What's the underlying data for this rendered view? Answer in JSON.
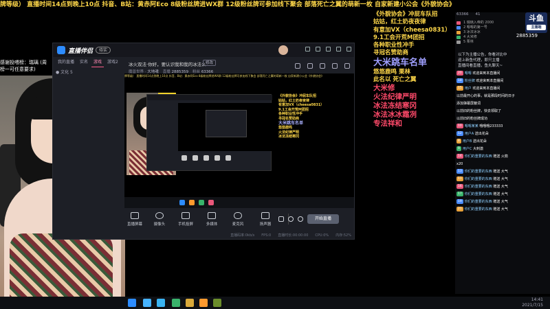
{
  "marquee": "牌等级） 直播时间14点到晚上10点 抖音、B站：黄赤阿Eco 8级粉丝牌进WX群 12级粉丝牌可参加线下聚会 部落死亡之翼的萌新一枚 自家新建小公会《外貌协会》",
  "cam_caption": "感谢投喂榜：瑞璃 (周榜一可任意要求)",
  "overlay": {
    "lines": [
      "《外貌协会》冲屁车队招",
      "姑姑，红土奶夜夜律",
      "有意加VX（cheesa0831）",
      "9.1工会开荒M团招",
      "各种职业性冲手",
      "寻冠名赞助商"
    ],
    "title": "大米跳车名单",
    "names": [
      "悠悠鹿鸣",
      "栗林",
      "此名以",
      "死亡之翼",
      "大米修",
      "火法纪律严明",
      "冰法冻结寒冈",
      "冰法冰冰霜冽",
      "专法祥和"
    ]
  },
  "app": {
    "name": "直播伴侣",
    "badge": "待实",
    "tabs": [
      "我的直播",
      "实名",
      "游戏",
      "游戏2"
    ],
    "sub": "● 文化 5",
    "room_title": "冰火双法·你好，要认识我和我的冰法么",
    "room_edit": "修改",
    "meta": [
      {
        "k": "魔兽世界",
        "v": "大地魂"
      },
      {
        "k": "直播",
        "v": "2885359"
      },
      {
        "k": "粉丝",
        "v": "63366"
      }
    ],
    "preview_strip": "牌等级） 直播时间14点到晚上10点 抖音、B站：黄赤阿Eco 8级粉丝牌进WX群 12级粉丝牌可参加线下聚会 部落死亡之翼的萌新一枚 自家新建小公会《外貌协会》",
    "preview_text": [
      "《外貌协会》冲屁车队招",
      "姑姑，红土奶夜夜律",
      "有意加VX（cheesa0831）",
      "9.1工会开荒M团招",
      "各种职业性冲手",
      "寻冠名赞助商",
      "大米跳车名单",
      "悠悠鹿鸣",
      "火法纪律严明",
      "冰法冻结寒冈"
    ],
    "tools": [
      "直播屏幕",
      "摄像头",
      "手机投屏",
      "多媒体",
      "麦克风",
      "扬声器"
    ],
    "start": "开始直播",
    "status": [
      "直播码率:0kb/s",
      "FPS:0",
      "直播时长:00:00:00",
      "CPU:0%",
      "内存:52%"
    ]
  },
  "rpanel": {
    "stats": [
      "63366",
      "41"
    ],
    "rank": [
      "1 瑞璃入帝的 2000",
      "2 嗯嗯的第一号",
      "3 冰法冰冰",
      "4 大米修",
      "5 栗林"
    ],
    "douyu": "斗鱼",
    "douyu_sub": "主播端",
    "room_num": "2885359",
    "notice": [
      "以下为主播公告，你看对比中",
      "迎上新鱼代理，即只主播",
      "直播间看直播，鱼丸聊天~"
    ],
    "chat": [
      {
        "lv": "20",
        "c": "#e9577a",
        "nm": "嗯嗯",
        "tx": "欢迎来到本直播间"
      },
      {
        "lv": "18",
        "c": "#4a8cff",
        "nm": "粉丝牌",
        "tx": "欢迎来到本直播间"
      },
      {
        "lv": "15",
        "c": "#e9a23a",
        "nm": "用户",
        "tx": "欢迎来到本直播间"
      },
      {
        "lv": "",
        "c": "",
        "nm": "",
        "tx": "以前最开心的事，就是那段时间的日子"
      },
      {
        "lv": "",
        "c": "",
        "nm": "",
        "tx": "添加弹幕屏蔽词"
      },
      {
        "lv": "",
        "c": "",
        "nm": "",
        "tx": "以前旧的粉丝牌，快去领取了"
      },
      {
        "lv": "",
        "c": "",
        "nm": "",
        "tx": "以前旧的粉丝牌成功"
      },
      {
        "lv": "10",
        "c": "#e9577a",
        "nm": "嗯嗯某某",
        "tx": "哦哦哦233333"
      },
      {
        "lv": "12",
        "c": "#4a8cff",
        "nm": "用户A",
        "tx": "送出花朵"
      },
      {
        "lv": "8",
        "c": "#e9a23a",
        "nm": "用户B",
        "tx": "送出花朵"
      },
      {
        "lv": "9",
        "c": "#39b36b",
        "nm": "用户C",
        "tx": "大刺激"
      },
      {
        "lv": "14",
        "c": "#e9577a",
        "nm": "你们的重要的东西",
        "tx": "赠送 火箭"
      },
      {
        "lv": "",
        "c": "",
        "nm": "",
        "tx": "x20"
      },
      {
        "lv": "13",
        "c": "#4a8cff",
        "nm": "你们的重要的东西",
        "tx": "赠送 大气"
      },
      {
        "lv": "11",
        "c": "#e9a23a",
        "nm": "你们的重要的东西",
        "tx": "赠送 大气"
      },
      {
        "lv": "16",
        "c": "#e9577a",
        "nm": "你们的重要的东西",
        "tx": "赠送 大气"
      },
      {
        "lv": "17",
        "c": "#39b36b",
        "nm": "你们的重要的东西",
        "tx": "赠送 大气"
      },
      {
        "lv": "19",
        "c": "#4a8cff",
        "nm": "你们的重要的东西",
        "tx": "赠送 大气"
      },
      {
        "lv": "21",
        "c": "#e9a23a",
        "nm": "你们的重要的东西",
        "tx": "赠送 大气"
      }
    ]
  },
  "taskbar": {
    "time": "14:41",
    "date": "2021/7/15"
  }
}
